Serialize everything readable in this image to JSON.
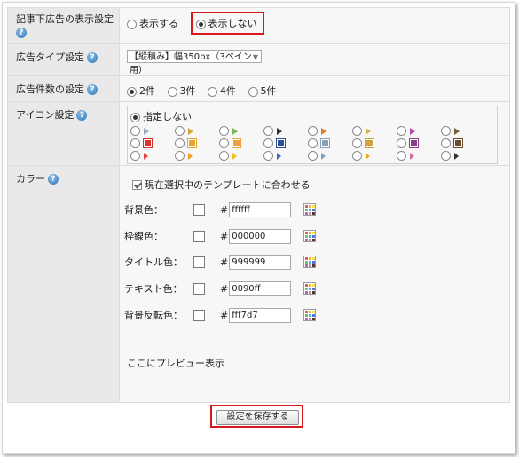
{
  "display_setting": {
    "label": "記事下広告の表示設定",
    "options": [
      "表示する",
      "表示しない"
    ],
    "selected": "表示しない"
  },
  "ad_type": {
    "label": "広告タイプ設定",
    "value": "【縦積み】幅350px（3ペイン用）"
  },
  "ad_count": {
    "label": "広告件数の設定",
    "options": [
      "2件",
      "3件",
      "4件",
      "5件"
    ],
    "selected": "2件"
  },
  "icon_setting": {
    "label": "アイコン設定",
    "none_option": "指定しない",
    "none_selected": true,
    "icons": [
      {
        "shape": "arrow",
        "color": "#9aa7b8"
      },
      {
        "shape": "arrow",
        "color": "#d6a63a"
      },
      {
        "shape": "arrow",
        "color": "#7db35c"
      },
      {
        "shape": "arrow",
        "color": "#333333"
      },
      {
        "shape": "arrow",
        "color": "#e07b2a"
      },
      {
        "shape": "arrow",
        "color": "#d2b24a"
      },
      {
        "shape": "arrow",
        "color": "#b44aa8"
      },
      {
        "shape": "arrow",
        "color": "#7a5d3a"
      },
      {
        "shape": "square",
        "color": "#d9312b"
      },
      {
        "shape": "square",
        "color": "#e6a52e"
      },
      {
        "shape": "square",
        "color": "#f0a040"
      },
      {
        "shape": "square",
        "color": "#2c4f8f"
      },
      {
        "shape": "square",
        "color": "#8aa0b8"
      },
      {
        "shape": "square",
        "color": "#cfa43a"
      },
      {
        "shape": "square",
        "color": "#8a3d8a"
      },
      {
        "shape": "square",
        "color": "#6b4a2e"
      },
      {
        "shape": "tri",
        "color": "#e04040"
      },
      {
        "shape": "tri",
        "color": "#f0a020"
      },
      {
        "shape": "tri",
        "color": "#f0c020"
      },
      {
        "shape": "tri",
        "color": "#3a6ab0"
      },
      {
        "shape": "tri",
        "color": "#7fa3c8"
      },
      {
        "shape": "tri",
        "color": "#e0b020"
      },
      {
        "shape": "tri",
        "color": "#d070a0"
      },
      {
        "shape": "tri",
        "color": "#333333"
      }
    ]
  },
  "color_setting": {
    "label": "カラー",
    "match_template_label": "現在選択中のテンプレートに合わせる",
    "match_template_checked": true,
    "rows": [
      {
        "label": "背景色：",
        "value": "ffffff"
      },
      {
        "label": "枠線色：",
        "value": "000000"
      },
      {
        "label": "タイトル色：",
        "value": "999999"
      },
      {
        "label": "テキスト色：",
        "value": "0090ff"
      },
      {
        "label": "背景反転色：",
        "value": "fff7d7"
      }
    ],
    "hash": "#",
    "preview_text": "ここにプレビュー表示"
  },
  "help_icon": "?",
  "save_button": "設定を保存する"
}
